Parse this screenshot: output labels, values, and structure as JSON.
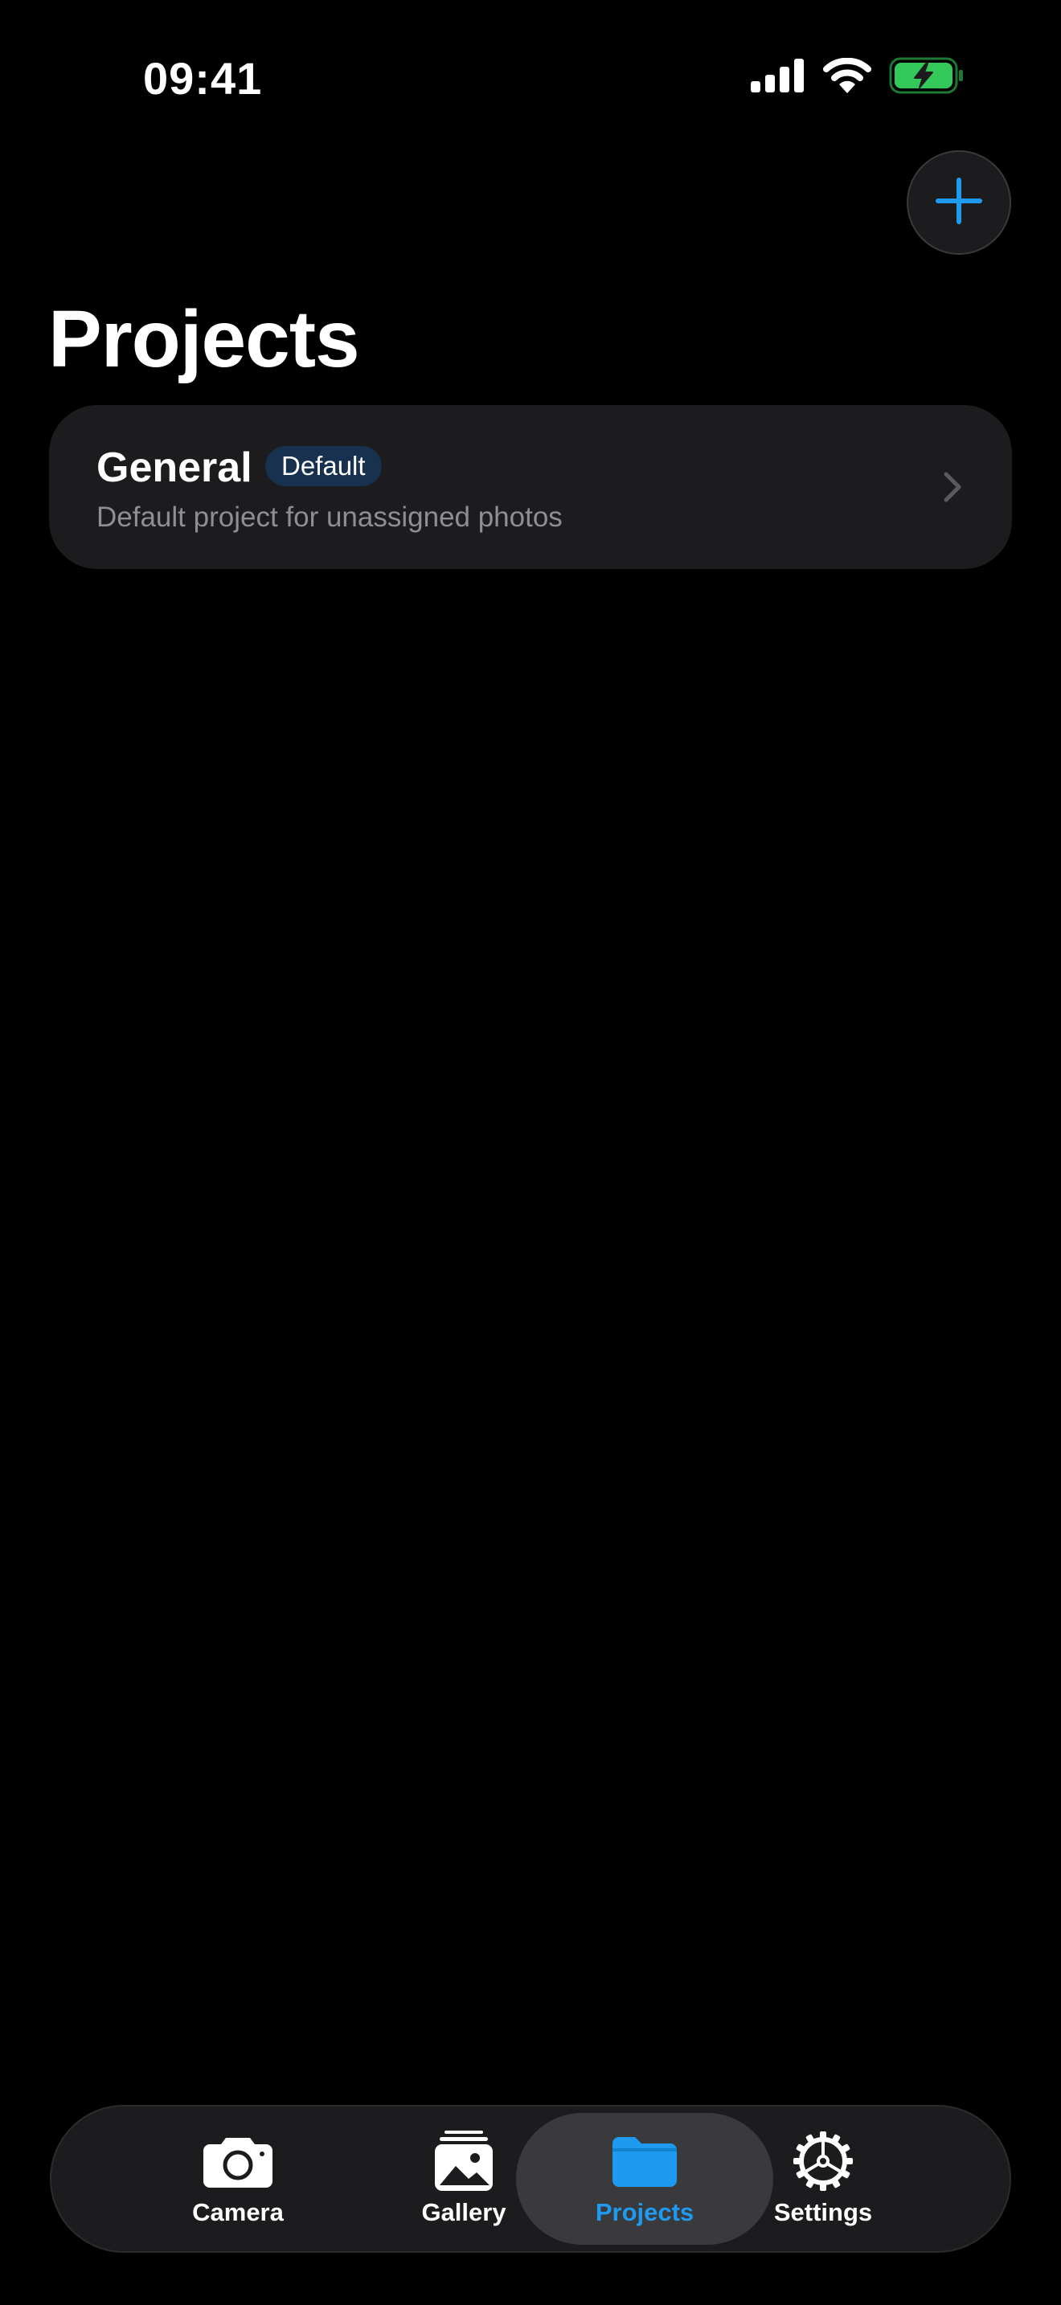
{
  "status_bar": {
    "time": "09:41",
    "signal_icon": "cellular-signal-icon",
    "wifi_icon": "wifi-icon",
    "battery_icon": "battery-charging-icon"
  },
  "header": {
    "title": "Projects",
    "add_icon": "plus-icon"
  },
  "projects": [
    {
      "name": "General",
      "badge": "Default",
      "description": "Default project for unassigned photos",
      "chevron_icon": "chevron-right-icon"
    }
  ],
  "tab_bar": {
    "active": "Projects",
    "tabs": [
      {
        "label": "Camera",
        "icon": "camera-icon"
      },
      {
        "label": "Gallery",
        "icon": "gallery-icon"
      },
      {
        "label": "Projects",
        "icon": "folder-icon"
      },
      {
        "label": "Settings",
        "icon": "gear-icon"
      }
    ]
  },
  "colors": {
    "background": "#000000",
    "card": "#1c1c1e",
    "accent": "#1e9bf0",
    "badge_background": "#17314f",
    "secondary_text": "#8e8e93",
    "battery_fill": "#34c759"
  }
}
